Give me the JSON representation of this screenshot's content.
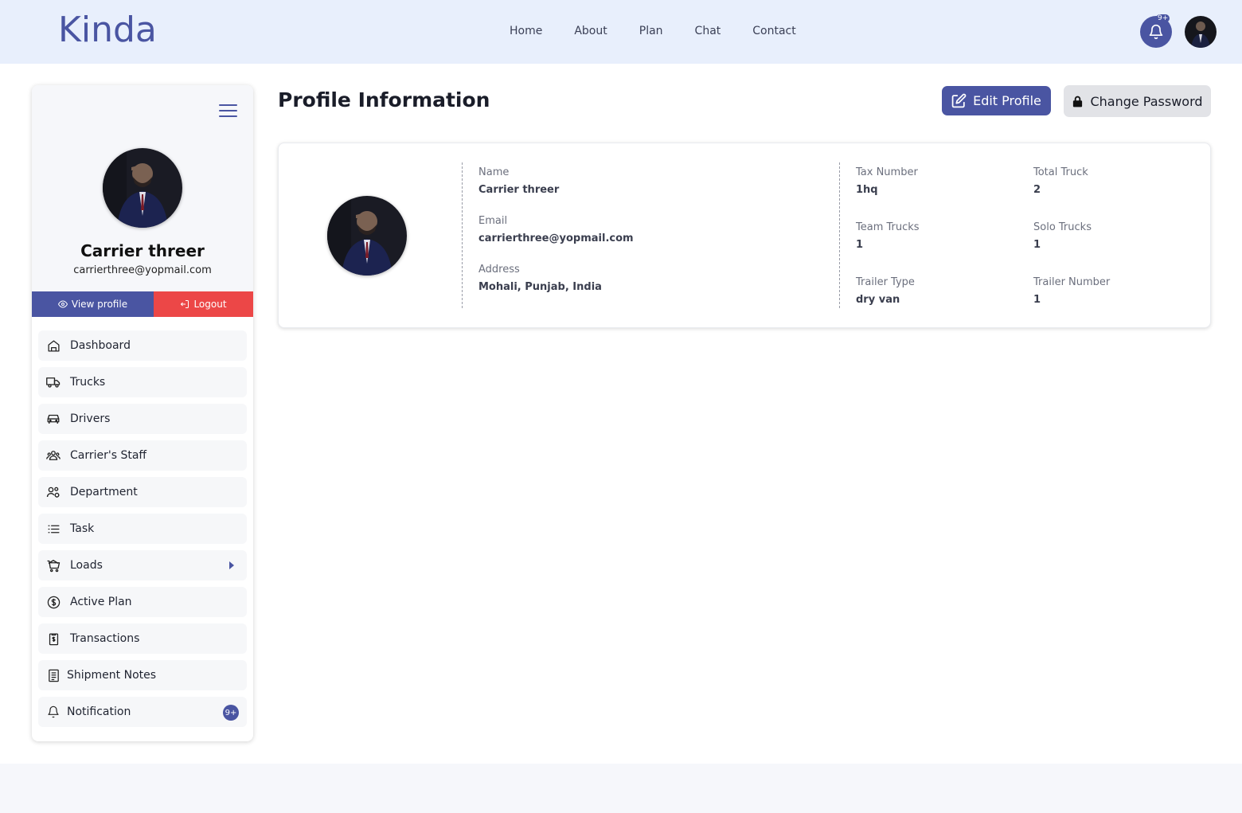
{
  "header": {
    "logo": "Kinda",
    "nav": [
      "Home",
      "About",
      "Plan",
      "Chat",
      "Contact"
    ],
    "notification_badge": "9+"
  },
  "sidebar": {
    "user_name": "Carrier threer",
    "user_email": "carrierthree@yopmail.com",
    "view_profile_label": "View profile",
    "logout_label": "Logout",
    "menu": [
      {
        "label": "Dashboard",
        "icon": "home-icon"
      },
      {
        "label": "Trucks",
        "icon": "truck-icon"
      },
      {
        "label": "Drivers",
        "icon": "car-icon"
      },
      {
        "label": "Carrier's Staff",
        "icon": "staff-icon"
      },
      {
        "label": "Department",
        "icon": "department-icon"
      },
      {
        "label": "Task",
        "icon": "list-icon"
      },
      {
        "label": "Loads",
        "icon": "cart-icon"
      },
      {
        "label": "Active Plan",
        "icon": "dollar-icon"
      },
      {
        "label": "Transactions",
        "icon": "receipt-icon"
      },
      {
        "label": "Shipment Notes",
        "icon": "notes-icon"
      },
      {
        "label": "Notification",
        "icon": "bell-icon",
        "badge": "9+"
      }
    ]
  },
  "main": {
    "title": "Profile Information",
    "edit_label": "Edit Profile",
    "password_label": "Change Password",
    "fields": {
      "name_label": "Name",
      "name_value": "Carrier threer",
      "email_label": "Email",
      "email_value": "carrierthree@yopmail.com",
      "address_label": "Address",
      "address_value": "Mohali, Punjab, India",
      "tax_label": "Tax Number",
      "tax_value": "1hq",
      "total_truck_label": "Total Truck",
      "total_truck_value": "2",
      "team_trucks_label": "Team Trucks",
      "team_trucks_value": "1",
      "solo_trucks_label": "Solo Trucks",
      "solo_trucks_value": "1",
      "trailer_type_label": "Trailer Type",
      "trailer_type_value": "dry van",
      "trailer_number_label": "Trailer Number",
      "trailer_number_value": "1"
    }
  },
  "colors": {
    "brand": "#4a55a2",
    "danger": "#ec4747",
    "header_bg": "#e8effc"
  }
}
